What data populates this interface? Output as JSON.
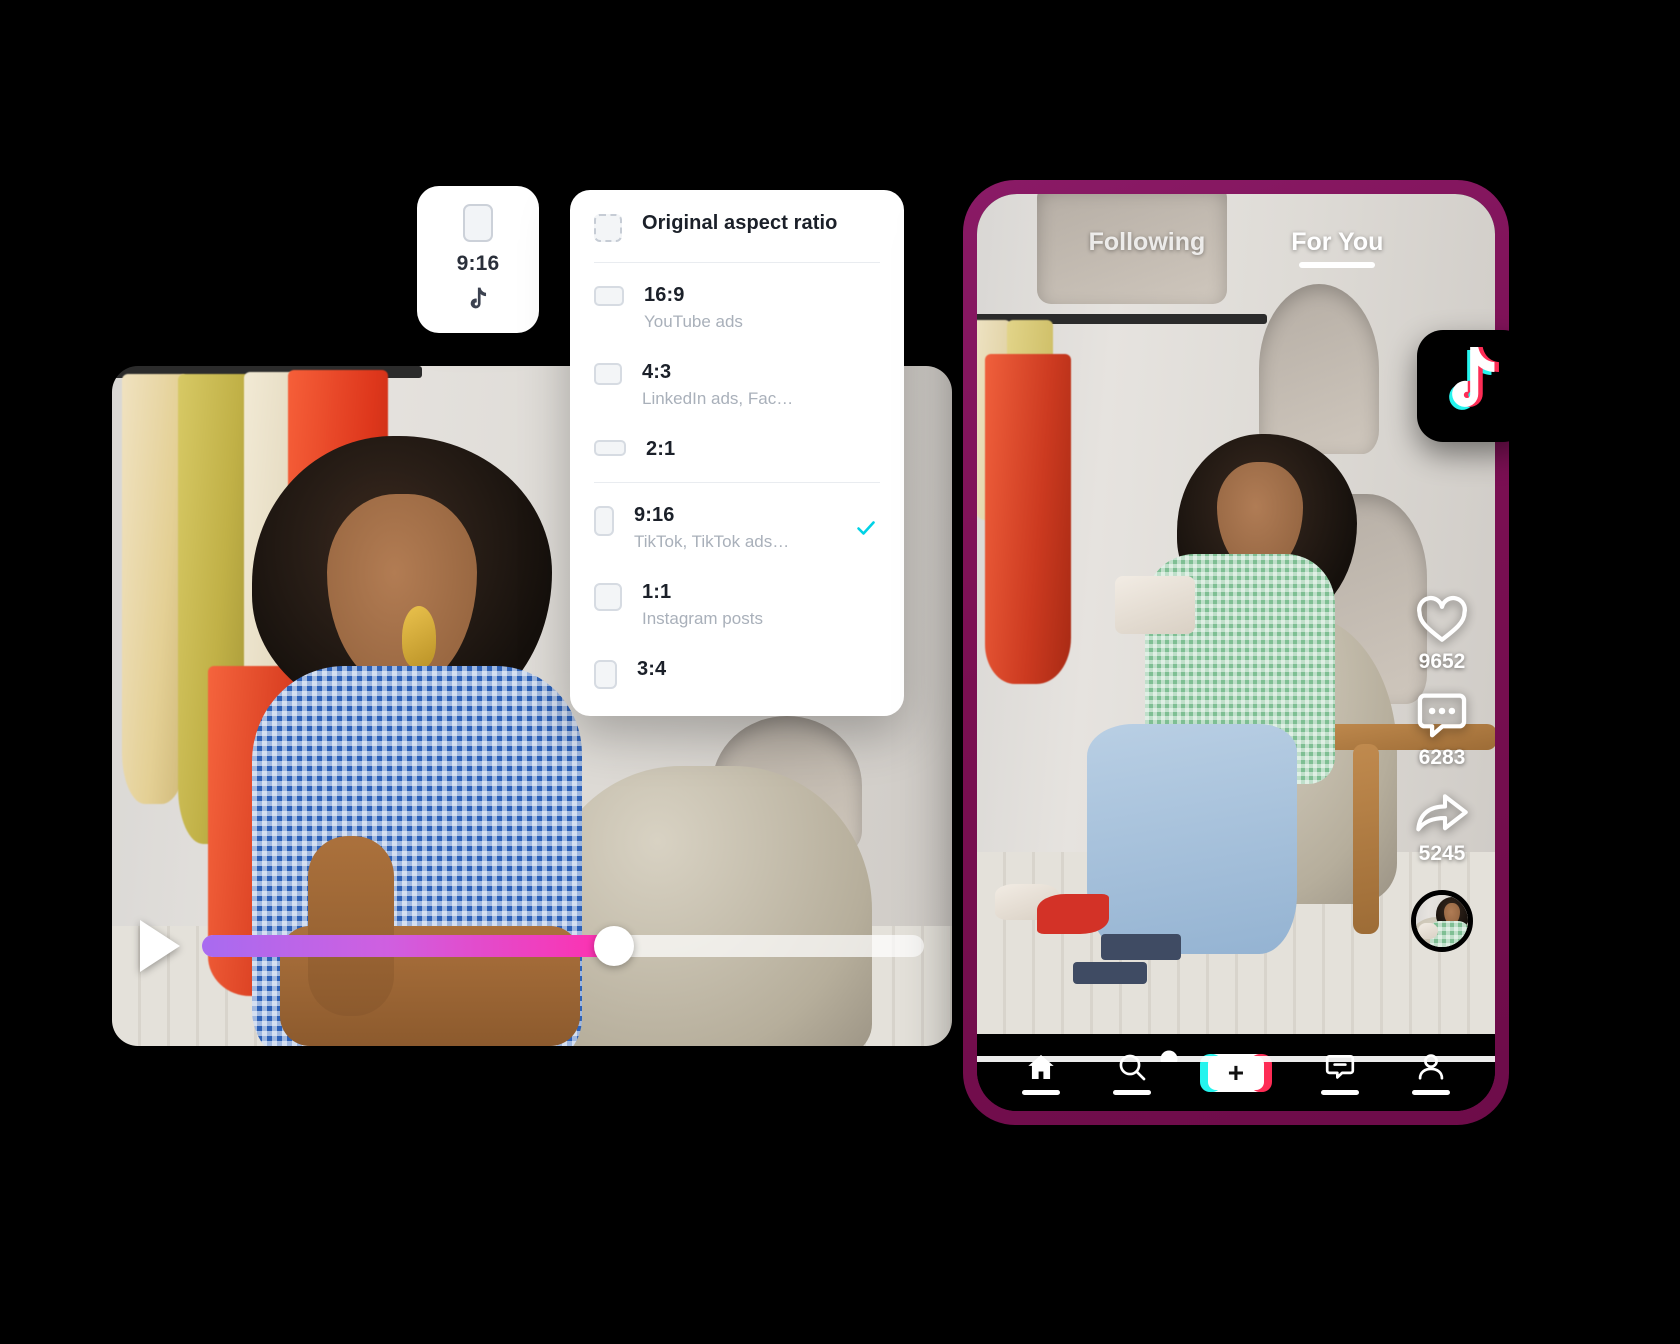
{
  "ratio_badge": {
    "label": "9:16",
    "icon": "portrait-rect-icon",
    "brand_icon": "tiktok-note-icon"
  },
  "ratio_menu": {
    "header": {
      "label": "Original aspect ratio",
      "icon": "dashed-square-icon"
    },
    "items": [
      {
        "label": "16:9",
        "sub": "YouTube ads",
        "icon": "ratio-16-9-icon",
        "selected": false
      },
      {
        "label": "4:3",
        "sub": "LinkedIn ads, Fac…",
        "icon": "ratio-4-3-icon",
        "selected": false
      },
      {
        "label": "2:1",
        "sub": "",
        "icon": "ratio-2-1-icon",
        "selected": false
      },
      {
        "label": "9:16",
        "sub": "TikTok, TikTok ads…",
        "icon": "ratio-9-16-icon",
        "selected": true
      },
      {
        "label": "1:1",
        "sub": "Instagram posts",
        "icon": "ratio-1-1-icon",
        "selected": false
      },
      {
        "label": "3:4",
        "sub": "",
        "icon": "ratio-3-4-icon",
        "selected": false
      }
    ],
    "check_color": "#00d2e6"
  },
  "player": {
    "play_icon": "play-icon",
    "progress_percent": 57,
    "progress_gradient_from": "#a86bf0",
    "progress_gradient_to": "#ff2fae"
  },
  "phone": {
    "frame_color": "#7a0f52",
    "tabs": [
      {
        "label": "Following",
        "active": false
      },
      {
        "label": "For You",
        "active": true
      }
    ],
    "actions": [
      {
        "icon": "heart-icon",
        "count": "9652"
      },
      {
        "icon": "comment-icon",
        "count": "6283"
      },
      {
        "icon": "share-icon",
        "count": "5245"
      }
    ],
    "avatar": "avatar",
    "scrub_percent": 37,
    "nav": [
      {
        "icon": "home-icon",
        "name": "home"
      },
      {
        "icon": "search-icon",
        "name": "discover"
      },
      {
        "icon": "plus-icon",
        "name": "create",
        "label": "+"
      },
      {
        "icon": "inbox-icon",
        "name": "inbox"
      },
      {
        "icon": "profile-icon",
        "name": "profile"
      }
    ]
  },
  "tiktok_logo": {
    "icon": "tiktok-logo-icon",
    "cyan": "#25f4ee",
    "pink": "#fe2c55"
  }
}
